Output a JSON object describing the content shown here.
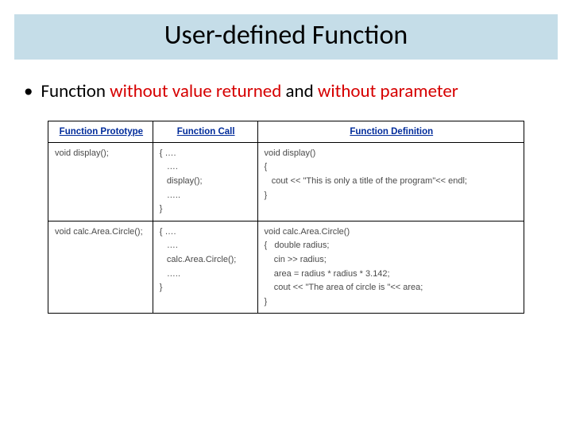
{
  "title": "User-defined Function",
  "bullet": {
    "pre": "Function ",
    "hl1": "without value returned",
    "mid": " and ",
    "hl2": "without parameter"
  },
  "table": {
    "headers": {
      "prototype": "Function Prototype",
      "call": "Function Call",
      "definition": "Function Definition"
    },
    "rows": [
      {
        "prototype": "void display();",
        "call": "{ ….\n   ….\n   display();\n   …..\n}",
        "definition": "void display()\n{\n   cout << \"This is only a title of the program\"<< endl;\n}"
      },
      {
        "prototype": "void calc.Area.Circle();",
        "call": "{ ….\n   ….\n   calc.Area.Circle();\n   …..\n}",
        "definition": "void calc.Area.Circle()\n{   double radius;\n    cin >> radius;\n    area = radius * radius * 3.142;\n    cout << \"The area of circle is \"<< area;\n}"
      }
    ]
  }
}
